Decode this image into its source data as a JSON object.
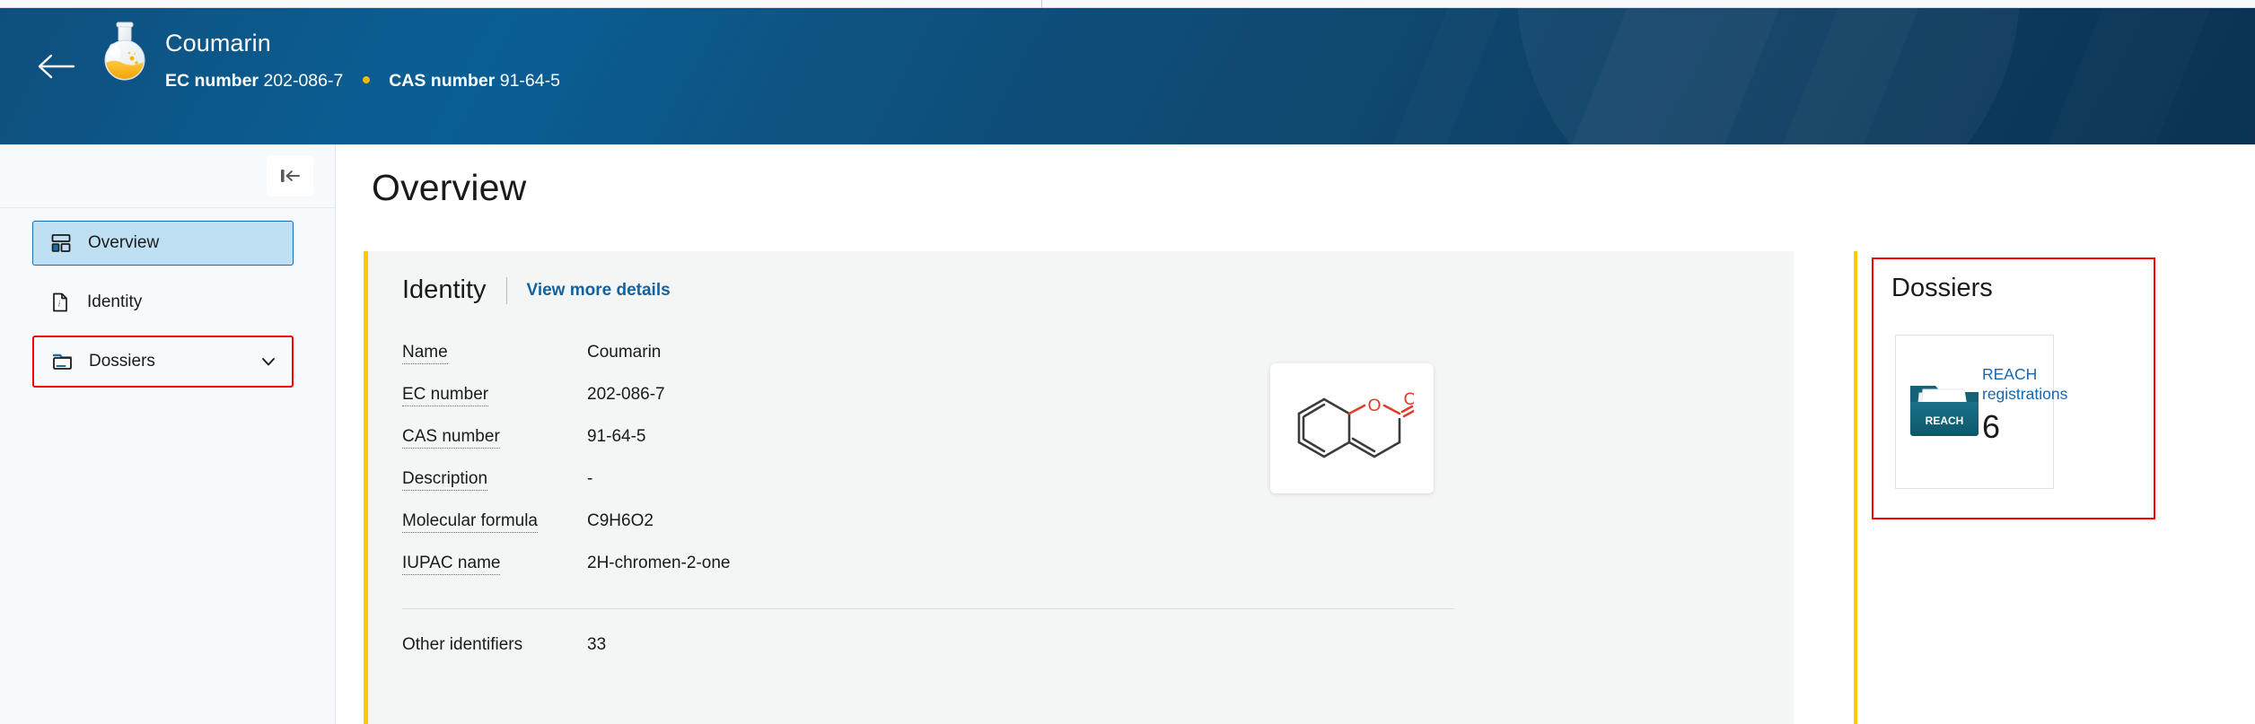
{
  "header": {
    "back_icon": "back-arrow-icon",
    "substance_icon": "flask-icon",
    "title": "Coumarin",
    "ec_label": "EC number",
    "ec_value": "202-086-7",
    "cas_label": "CAS number",
    "cas_value": "91-64-5",
    "separator_color": "#f5b800",
    "gradient_from": "#0a5f95",
    "gradient_to": "#0a3353"
  },
  "sidebar": {
    "collapse_icon": "collapse-panel-icon",
    "items": [
      {
        "label": "Overview",
        "icon": "dashboard-icon",
        "active": true,
        "expandable": false
      },
      {
        "label": "Identity",
        "icon": "document-info-icon",
        "active": false,
        "expandable": false
      },
      {
        "label": "Dossiers",
        "icon": "folder-icon",
        "active": false,
        "expandable": true,
        "chevron": "chevron-down-icon"
      }
    ]
  },
  "main": {
    "page_title": "Overview",
    "identity": {
      "heading": "Identity",
      "view_more_label": "View more details",
      "accent_color": "#ffc800",
      "rows": [
        {
          "key": "Name",
          "value": "Coumarin"
        },
        {
          "key": "EC number",
          "value": "202-086-7"
        },
        {
          "key": "CAS number",
          "value": "91-64-5"
        },
        {
          "key": "Description",
          "value": "-"
        },
        {
          "key": "Molecular formula",
          "value": "C9H6O2"
        },
        {
          "key": "IUPAC name",
          "value": "2H-chromen-2-one"
        }
      ],
      "other_identifiers_key": "Other identifiers",
      "other_identifiers_value": "33",
      "structure_image_alt": "coumarin-structure"
    }
  },
  "dossiers_panel": {
    "title": "Dossiers",
    "highlight_color": "#ff0000",
    "tile": {
      "icon": "reach-folder-icon",
      "icon_text": "REACH",
      "label": "REACH registrations",
      "label_line1": "REACH",
      "label_line2": "registrations",
      "count": "6",
      "link_color": "#1766b0"
    }
  }
}
